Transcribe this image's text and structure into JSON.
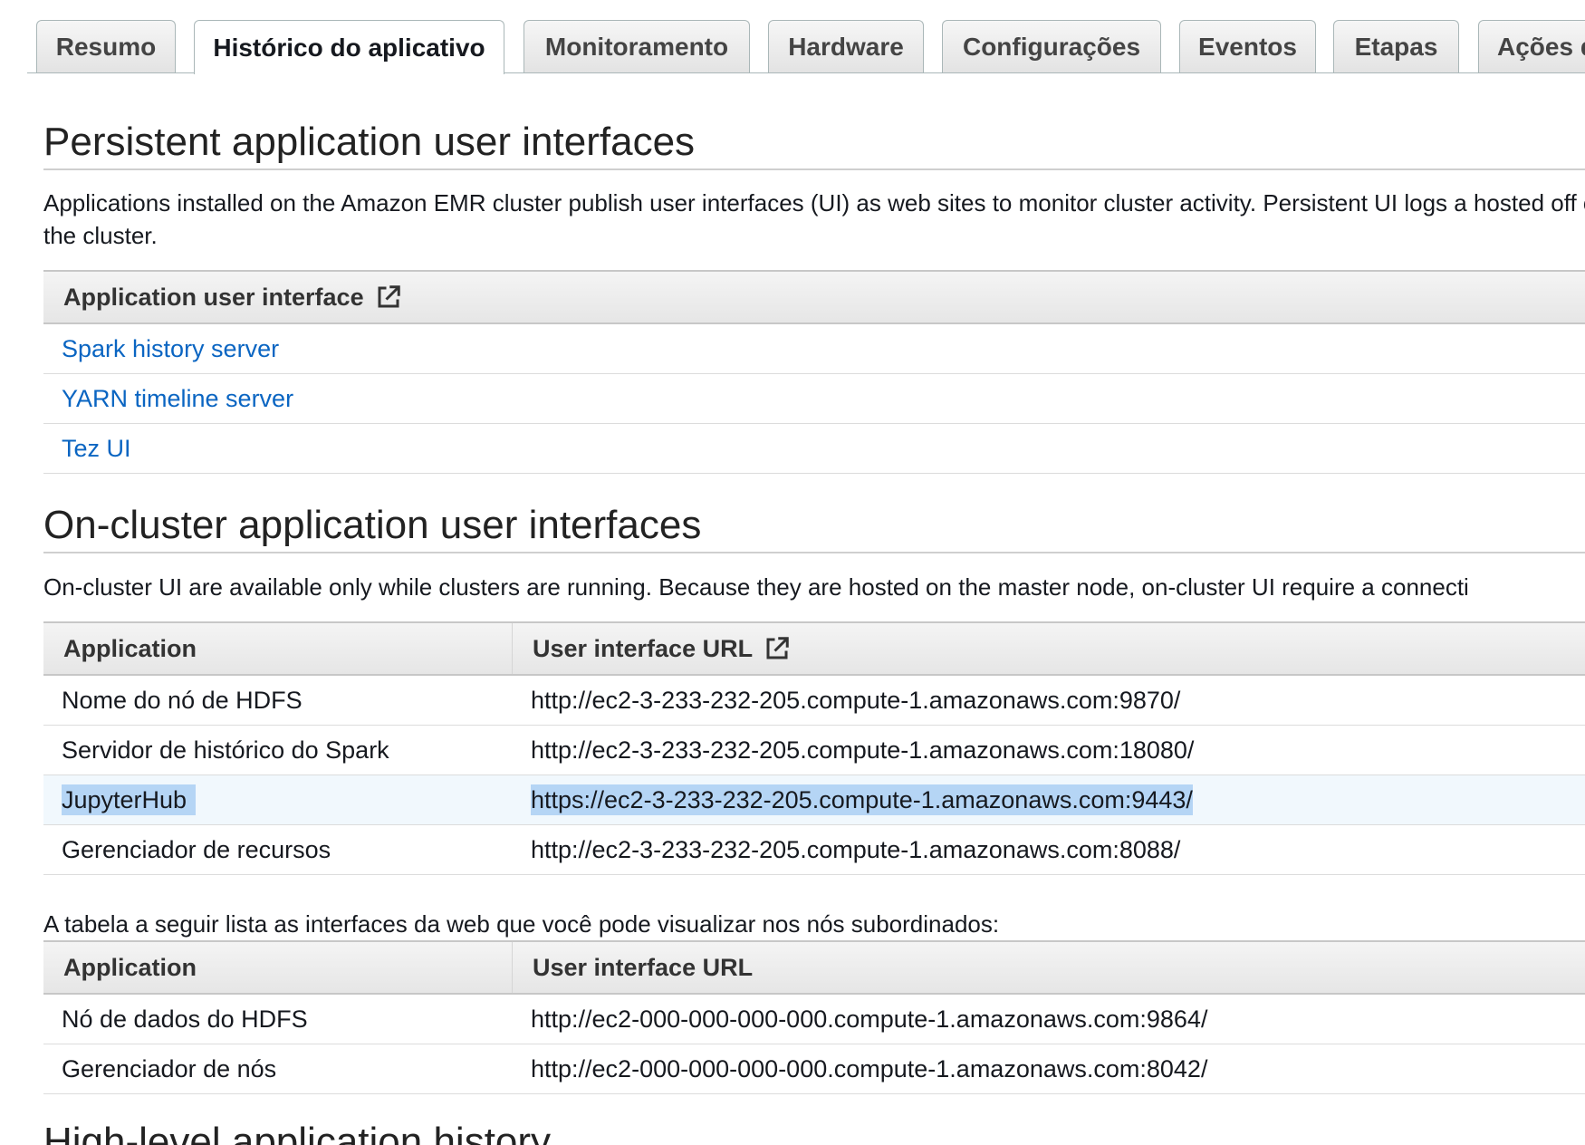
{
  "tabs": [
    {
      "label": "Resumo",
      "active": false
    },
    {
      "label": "Histórico do aplicativo",
      "active": true
    },
    {
      "label": "Monitoramento",
      "active": false
    },
    {
      "label": "Hardware",
      "active": false
    },
    {
      "label": "Configurações",
      "active": false
    },
    {
      "label": "Eventos",
      "active": false
    },
    {
      "label": "Etapas",
      "active": false
    },
    {
      "label": "Ações d",
      "active": false
    }
  ],
  "persistent": {
    "title": "Persistent application user interfaces",
    "description": "Applications installed on the Amazon EMR cluster publish user interfaces (UI) as web sites to monitor cluster activity. Persistent UI logs a hosted off of the cluster.",
    "header": "Application user interface",
    "header_icon": "external-link-icon",
    "links": [
      "Spark history server",
      "YARN timeline server",
      "Tez UI"
    ]
  },
  "oncluster": {
    "title": "On-cluster application user interfaces",
    "description": "On-cluster UI are available only while clusters are running. Because they are hosted on the master node, on-cluster UI require a connecti",
    "col_application": "Application",
    "col_url": "User interface URL",
    "header_icon": "external-link-icon",
    "rows": [
      {
        "app": "Nome do nó de HDFS",
        "url": "http://ec2-3-233-232-205.compute-1.amazonaws.com:9870/"
      },
      {
        "app": "Servidor de histórico do Spark",
        "url": "http://ec2-3-233-232-205.compute-1.amazonaws.com:18080/"
      },
      {
        "app": "JupyterHub",
        "url": "https://ec2-3-233-232-205.compute-1.amazonaws.com:9443/"
      },
      {
        "app": "Gerenciador de recursos",
        "url": "http://ec2-3-233-232-205.compute-1.amazonaws.com:8088/"
      }
    ]
  },
  "subordinate": {
    "intro": "A tabela a seguir lista as interfaces da web que você pode visualizar nos nós subordinados:",
    "col_application": "Application",
    "col_url": "User interface URL",
    "rows": [
      {
        "app": "Nó de dados do HDFS",
        "url": "http://ec2-000-000-000-000.compute-1.amazonaws.com:9864/"
      },
      {
        "app": "Gerenciador de nós",
        "url": "http://ec2-000-000-000-000.compute-1.amazonaws.com:8042/"
      }
    ]
  },
  "history": {
    "title": "High-level application history"
  },
  "colors": {
    "link": "#0a65c2",
    "selection": "#b5d5f5",
    "selected_row": "#f1f8fd"
  }
}
